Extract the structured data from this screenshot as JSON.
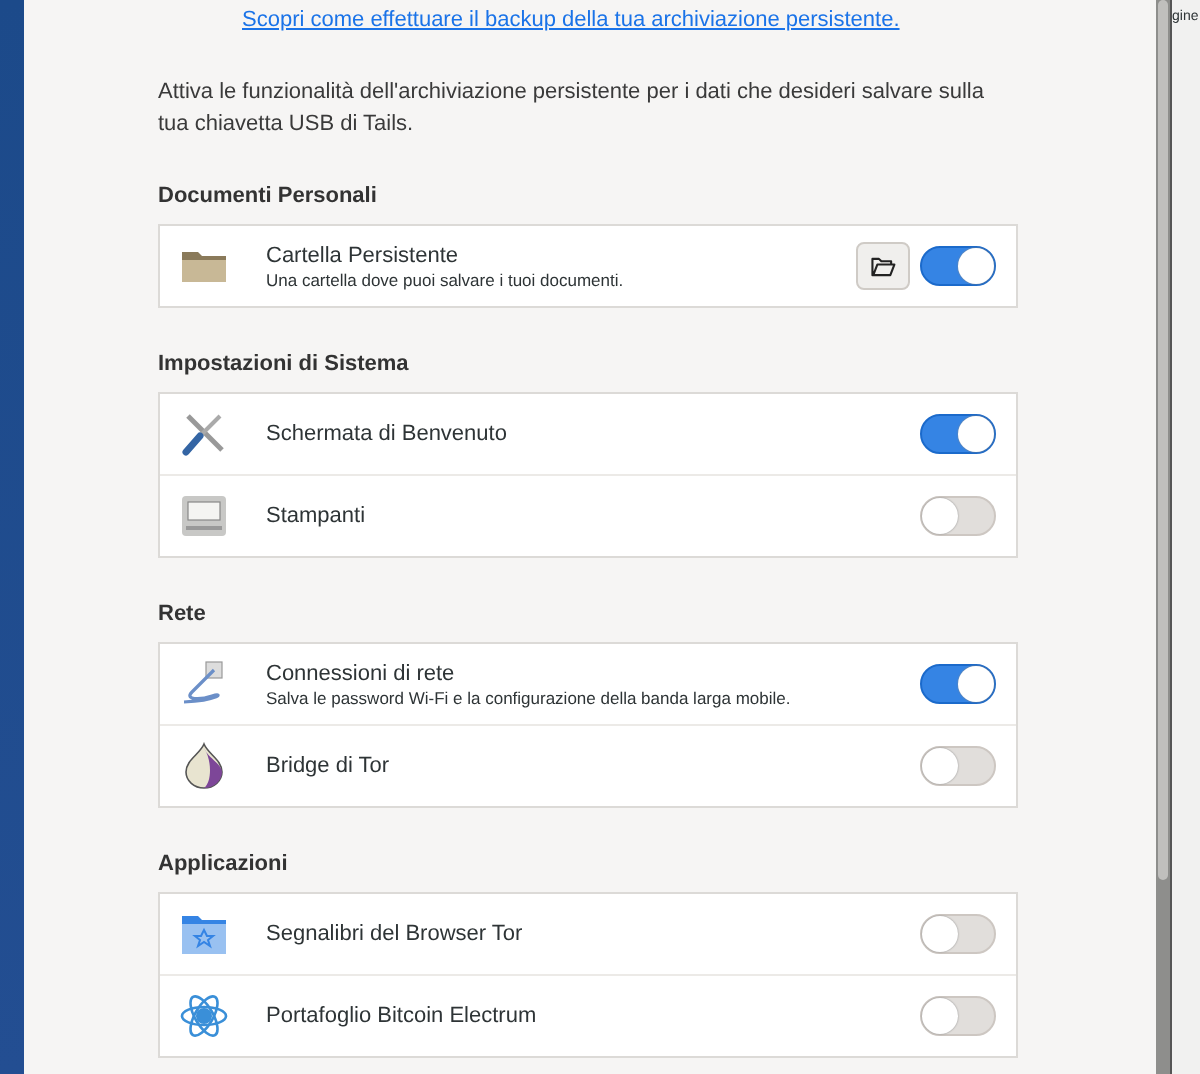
{
  "link": "Scopri come effettuare il backup della tua archiviazione persistente.",
  "intro": "Attiva le funzionalità dell'archiviazione persistente per i dati che desideri salvare sulla tua chiavetta USB di Tails.",
  "sections": [
    {
      "title": "Documenti Personali",
      "items": [
        {
          "kind": "folder",
          "name": "Cartella Persistente",
          "description": "Una cartella dove puoi salvare i tuoi documenti.",
          "open_button": true,
          "on": true
        }
      ]
    },
    {
      "title": "Impostazioni di Sistema",
      "items": [
        {
          "kind": "tools",
          "name": "Schermata di Benvenuto",
          "on": true
        },
        {
          "kind": "printer",
          "name": "Stampanti",
          "on": false
        }
      ]
    },
    {
      "title": "Rete",
      "items": [
        {
          "kind": "network",
          "name": "Connessioni di rete",
          "description": "Salva le password Wi-Fi e la configurazione della banda larga mobile.",
          "on": true
        },
        {
          "kind": "onion",
          "name": "Bridge di Tor",
          "on": false
        }
      ]
    },
    {
      "title": "Applicazioni",
      "items": [
        {
          "kind": "bookmarks",
          "name": "Segnalibri del Browser Tor",
          "on": false
        },
        {
          "kind": "electrum",
          "name": "Portafoglio Bitcoin Electrum",
          "on": false
        }
      ]
    }
  ],
  "background_window": {
    "text": "gine"
  }
}
